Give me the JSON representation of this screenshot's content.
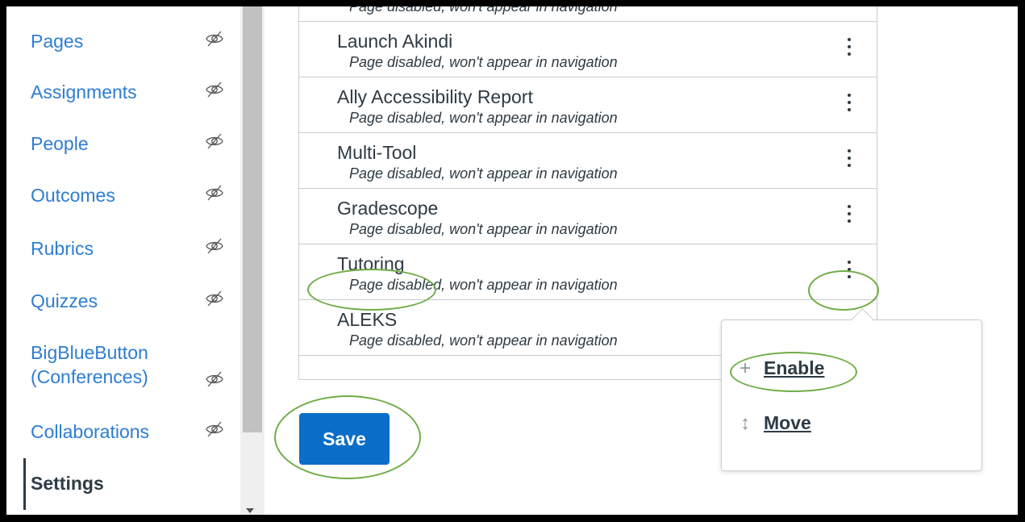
{
  "sidebar": {
    "items": [
      {
        "label": "Pages"
      },
      {
        "label": "Assignments"
      },
      {
        "label": "People"
      },
      {
        "label": "Outcomes"
      },
      {
        "label": "Rubrics"
      },
      {
        "label": "Quizzes"
      },
      {
        "label_line1": "BigBlueButton",
        "label_line2": "(Conferences)"
      },
      {
        "label": "Collaborations"
      },
      {
        "label": "Settings"
      }
    ]
  },
  "nav_list": {
    "top_partial_sub": "Page disabled, won't appear in navigation",
    "rows": [
      {
        "title": "Launch Akindi",
        "sub": "Page disabled, won't appear in navigation"
      },
      {
        "title": "Ally Accessibility Report",
        "sub": "Page disabled, won't appear in navigation"
      },
      {
        "title": "Multi-Tool",
        "sub": "Page disabled, won't appear in navigation"
      },
      {
        "title": "Gradescope",
        "sub": "Page disabled, won't appear in navigation"
      },
      {
        "title": "Tutoring",
        "sub": "Page disabled, won't appear in navigation"
      },
      {
        "title": "ALEKS",
        "sub": "Page disabled, won't appear in navigation"
      }
    ]
  },
  "actions": {
    "save_label": "Save"
  },
  "popover": {
    "enable_icon": "+",
    "enable_label": "Enable",
    "move_icon": "↕",
    "move_label": "Move"
  },
  "colors": {
    "link": "#2d7dd2",
    "text": "#2d3b45",
    "primary_button": "#0a6ec8",
    "annotation": "#70ad47",
    "border": "#c7cdd1"
  }
}
